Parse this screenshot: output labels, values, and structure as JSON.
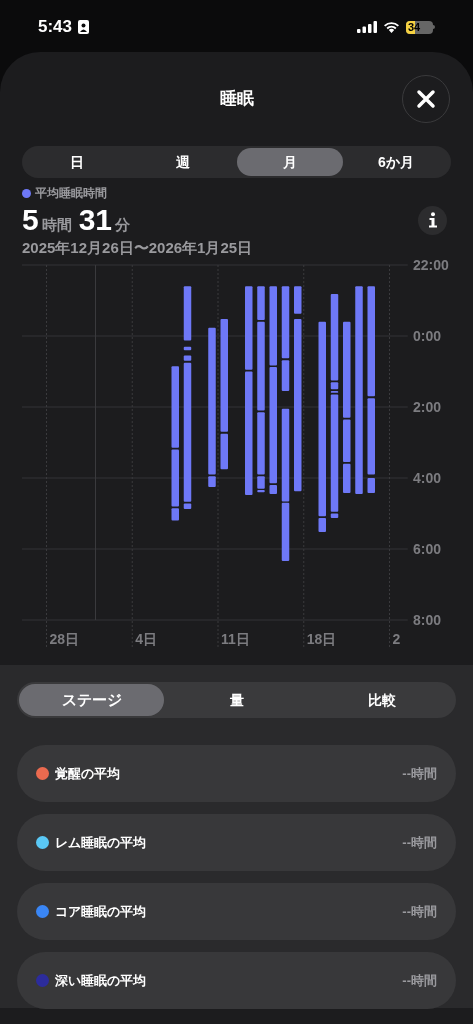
{
  "status_bar": {
    "time": "5:43",
    "battery": "34"
  },
  "header": {
    "title": "睡眠"
  },
  "period_tabs": [
    {
      "label": "日",
      "selected": false
    },
    {
      "label": "週",
      "selected": false
    },
    {
      "label": "月",
      "selected": true
    },
    {
      "label": "6か月",
      "selected": false
    }
  ],
  "summary": {
    "legend": "平均睡眠時間",
    "hours": "5",
    "hours_unit": "時間",
    "minutes": "31",
    "minutes_unit": "分",
    "range": "2025年12月26日〜2026年1月25日"
  },
  "chart": {
    "x_labels": [
      "28日",
      "4日",
      "11日",
      "18日",
      "2"
    ],
    "y_labels": [
      "22:00",
      "0:00",
      "2:00",
      "4:00",
      "6:00",
      "8:00"
    ]
  },
  "view_tabs": [
    {
      "label": "ステージ",
      "selected": true
    },
    {
      "label": "量",
      "selected": false
    },
    {
      "label": "比較",
      "selected": false
    }
  ],
  "stages": [
    {
      "label": "覚醒の平均",
      "value": "--時間",
      "color": "#eb6a4f"
    },
    {
      "label": "レム睡眠の平均",
      "value": "--時間",
      "color": "#5ac8f5"
    },
    {
      "label": "コア睡眠の平均",
      "value": "--時間",
      "color": "#3a86f5"
    },
    {
      "label": "深い睡眠の平均",
      "value": "--時間",
      "color": "#2c2c9c"
    }
  ]
}
